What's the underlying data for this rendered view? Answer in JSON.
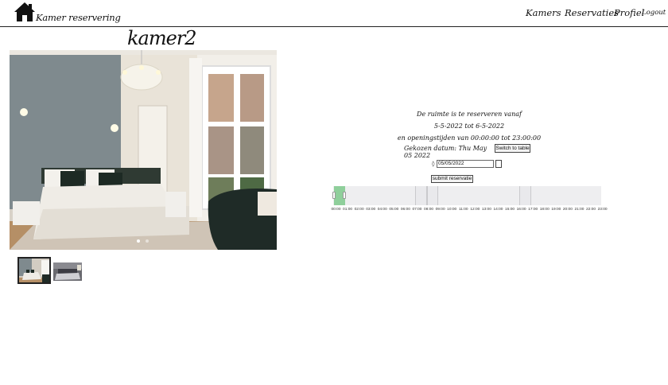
{
  "header": {
    "brand": "Kamer reservering",
    "nav": [
      "Kamers",
      "Reservaties",
      "Profiel"
    ],
    "logout": "Logout"
  },
  "room": {
    "title": "kamer2",
    "images": [
      "bedroom-photo-1",
      "bedroom-photo-2"
    ],
    "active_slide": 0
  },
  "availability": {
    "line1": "De ruimte is te reserveren vanaf",
    "line2": "5-5-2022  tot  6-5-2022",
    "line3": "en openingstijden van  00:00:00  tot  23:00:00",
    "chosen_date": "Gekozen datum: Thu May 05 2022",
    "switch_label": "Switch to table"
  },
  "form": {
    "date_value": "05/05/2022",
    "submit_label": "submit reservatie"
  },
  "timeline": {
    "ticks": [
      "00:00",
      "01:00",
      "02:00",
      "03:00",
      "04:00",
      "05:00",
      "06:00",
      "07:00",
      "08:00",
      "09:00",
      "10:00",
      "11:00",
      "12:00",
      "13:00",
      "14:00",
      "15:00",
      "16:00",
      "17:00",
      "18:00",
      "19:00",
      "20:00",
      "21:00",
      "22:00",
      "23:00"
    ],
    "selected": {
      "from": "00:00",
      "to": "01:00"
    },
    "booked": [
      [
        "07:00",
        "08:00"
      ],
      [
        "08:00",
        "09:00"
      ],
      [
        "16:00",
        "17:00"
      ]
    ]
  },
  "colors": {
    "selection": "#8fcf9b",
    "timeline_bg": "#eeeef0"
  }
}
